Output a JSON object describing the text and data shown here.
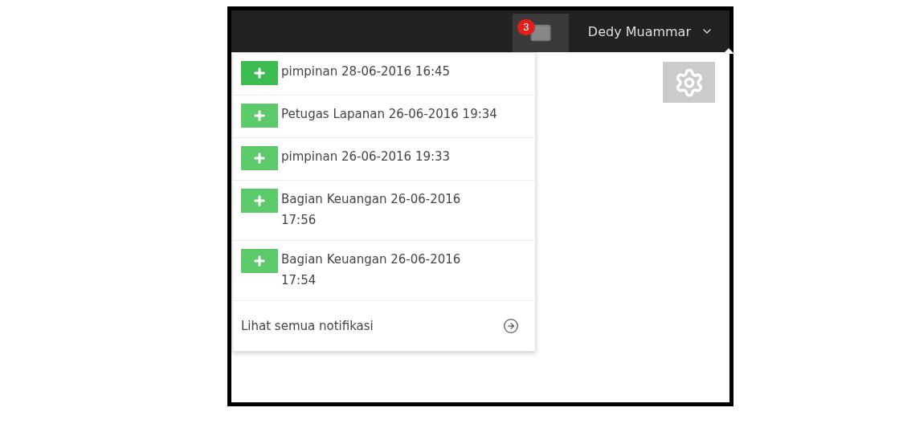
{
  "header": {
    "message_count": "3",
    "user_name": "Dedy Muammar"
  },
  "notifications": [
    {
      "text": "pimpinan 28-06-2016 16:45"
    },
    {
      "text": "Petugas Lapanan 26-06-2016 19:34"
    },
    {
      "text": "pimpinan 26-06-2016 19:33"
    },
    {
      "text": "Bagian Keuangan 26-06-2016\n17:56"
    },
    {
      "text": "Bagian Keuangan 26-06-2016\n17:54"
    }
  ],
  "footer_link": "Lihat semua notifikasi"
}
